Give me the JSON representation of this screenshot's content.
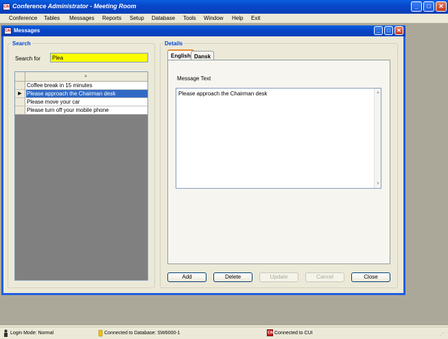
{
  "app": {
    "title": "Conference Administrator - Meeting Room",
    "logo_text": "CAI"
  },
  "menu": [
    "Conference",
    "Tables",
    "Messages",
    "Reports",
    "Setup",
    "Database",
    "Tools",
    "Window",
    "Help",
    "Exit"
  ],
  "child_window": {
    "title": "Messages"
  },
  "search": {
    "group_label": "Search",
    "label": "Search for",
    "value": "Plea"
  },
  "grid": {
    "rows": [
      {
        "text": "Coffee break in 15 minutes",
        "selected": false
      },
      {
        "text": "Please approach the Chairman desk",
        "selected": true
      },
      {
        "text": "Please move your car",
        "selected": false
      },
      {
        "text": "Please turn off your mobile phone",
        "selected": false
      }
    ]
  },
  "details": {
    "group_label": "Details",
    "tabs": [
      {
        "label": "English",
        "active": true
      },
      {
        "label": "Dansk",
        "active": false
      }
    ],
    "message_text_label": "Message Text",
    "message_text": "Please approach the Chairman desk"
  },
  "buttons": {
    "add": "Add",
    "delete": "Delete",
    "update": "Update",
    "cancel": "Cancel",
    "close": "Close"
  },
  "status": {
    "login": "Login Mode: Normal",
    "database": "Connected to Database: SW6000-1",
    "cui": "Connected to CUI"
  },
  "colors": {
    "titlebar": "#0846c9",
    "search_highlight": "#ffff00",
    "selection": "#316ac5",
    "group_label": "#0046d5"
  }
}
